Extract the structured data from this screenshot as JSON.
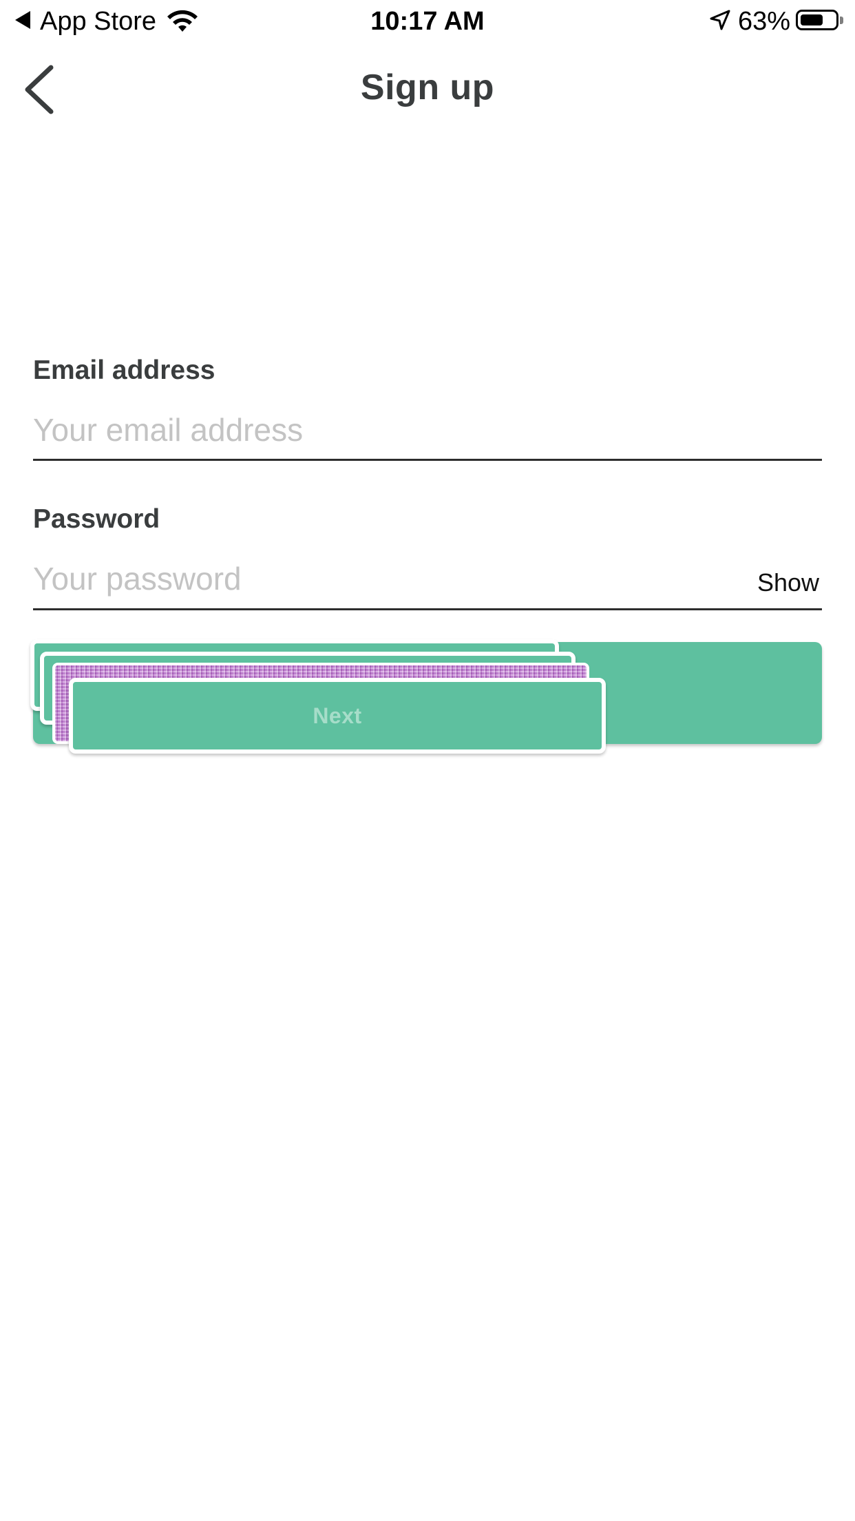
{
  "status_bar": {
    "back_app": "App Store",
    "time": "10:17 AM",
    "battery_percent": "63%",
    "battery_level": 0.63,
    "icons": [
      "back-triangle-icon",
      "wifi-icon",
      "location-arrow-icon",
      "battery-icon"
    ]
  },
  "nav": {
    "title": "Sign up",
    "back_icon": "chevron-left-icon"
  },
  "form": {
    "email": {
      "label": "Email address",
      "placeholder": "Your email address",
      "value": ""
    },
    "password": {
      "label": "Password",
      "placeholder": "Your password",
      "value": "",
      "toggle_label": "Show"
    },
    "next_button": {
      "label": "Next",
      "state": "disabled"
    }
  },
  "colors": {
    "accent": "#5ec09f",
    "next_label_disabled": "#a6ddc9",
    "placeholder": "#c3c3c3",
    "text": "#3a3d3e",
    "glitch": "#c889d8"
  }
}
